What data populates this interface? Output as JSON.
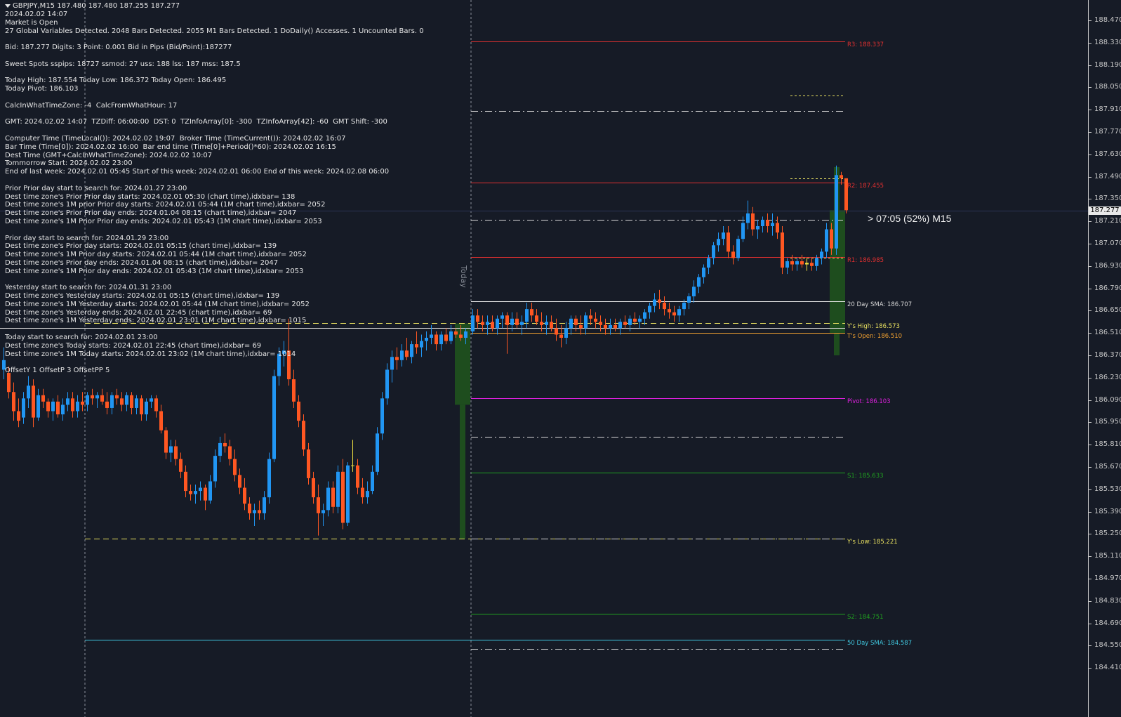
{
  "header": {
    "symbol_line": "GBPJPY,M15  187.480 187.480 187.255 187.277",
    "collapse_icon": "triangle-down-icon"
  },
  "info_lines": [
    "2024.02.02 14:07",
    "Market is Open",
    "27 Global Variables Detected. 2048 Bars Detected. 2055 M1 Bars Detected. 1 DoDaily() Accesses. 1 Uncounted Bars. 0",
    "",
    "Bid: 187.277 Digits: 3 Point: 0.001 Bid in Pips (Bid/Point):187277",
    "",
    "Sweet Spots sspips: 18727 ssmod: 27 uss: 188 lss: 187 mss: 187.5",
    "",
    "Today High: 187.554 Today Low: 186.372 Today Open: 186.495",
    "Today Pivot: 186.103",
    "",
    "CalcInWhatTimeZone: -4  CalcFromWhatHour: 17",
    "",
    "GMT: 2024.02.02 14:07  TZDiff: 06:00:00  DST: 0  TZInfoArray[0]: -300  TZInfoArray[42]: -60  GMT Shift: -300",
    "",
    "Computer Time (TimeLocal()): 2024.02.02 19:07  Broker Time (TimeCurrent()): 2024.02.02 16:07",
    "Bar Time (Time[0]): 2024.02.02 16:00  Bar end time (Time[0]+Period()*60): 2024.02.02 16:15",
    "Dest Time (GMT+CalcInWhatTimeZone): 2024.02.02 10:07",
    "Tommorrow Start: 2024.02.02 23:00",
    "End of last week: 2024.02.01 05:45 Start of this week: 2024.02.01 06:00 End of this week: 2024.02.08 06:00",
    "",
    "Prior Prior day start to search for: 2024.01.27 23:00",
    "Dest time zone's Prior Prior day starts: 2024.02.01 05:30 (chart time),idxbar= 138",
    "Dest time zone's 1M prior Prior day starts: 2024.02.01 05:44 (1M chart time),idxbar= 2052",
    "Dest time zone's Prior Prior day ends: 2024.01.04 08:15 (chart time),idxbar= 2047",
    "Dest time zone's 1M Prior Prior day ends: 2024.02.01 05:43 (1M chart time),idxbar= 2053",
    "",
    "Prior day start to search for: 2024.01.29 23:00",
    "Dest time zone's Prior day starts: 2024.02.01 05:15 (chart time),idxbar= 139",
    "Dest time zone's 1M Prior day starts: 2024.02.01 05:44 (1M chart time),idxbar= 2052",
    "Dest time zone's Prior day ends: 2024.01.04 08:15 (chart time),idxbar= 2047",
    "Dest time zone's 1M Prior day ends: 2024.02.01 05:43 (1M chart time),idxbar= 2053",
    "",
    "Yesterday start to search for: 2024.01.31 23:00",
    "Dest time zone's Yesterday starts: 2024.02.01 05:15 (chart time),idxbar= 139",
    "Dest time zone's 1M Yesterday starts: 2024.02.01 05:44 (1M chart time),idxbar= 2052",
    "Dest time zone's Yesterday ends: 2024.02.01 22:45 (chart time),idxbar= 69",
    "Dest time zone's 1M Yesterday ends: 2024.02.01 23:01 (1M chart time),idxbar= 1015",
    "",
    "Today start to search for: 2024.02.01 23:00",
    "Dest time zone's Today starts: 2024.02.01 22:45 (chart time),idxbar= 69",
    "Dest time zone's 1M Today starts: 2024.02.01 23:02 (1M chart time),idxbar= 1014",
    "",
    "OffsetY 1 OffsetP 3 OffsetPP 5"
  ],
  "price_axis": {
    "ticks": [
      "188.470",
      "188.330",
      "188.190",
      "188.050",
      "187.910",
      "187.770",
      "187.630",
      "187.490",
      "187.350",
      "187.210",
      "187.070",
      "186.930",
      "186.790",
      "186.650",
      "186.510",
      "186.370",
      "186.230",
      "186.090",
      "185.950",
      "185.810",
      "185.670",
      "185.530",
      "185.390",
      "185.250",
      "185.110",
      "184.970",
      "184.830",
      "184.690",
      "184.550",
      "184.410"
    ],
    "current_price": "187.277"
  },
  "levels": [
    {
      "name": "r3",
      "label": "R3: 188.337",
      "price": 188.337,
      "color": "#e03030",
      "style": "solid",
      "label_color": "#e03030"
    },
    {
      "name": "r2",
      "label": "R2: 187.455",
      "price": 187.455,
      "color": "#e03030",
      "style": "solid",
      "label_color": "#e03030"
    },
    {
      "name": "r1",
      "label": "R1: 186.985",
      "price": 186.985,
      "color": "#e03030",
      "style": "solid",
      "label_color": "#e03030"
    },
    {
      "name": "sma20",
      "label": "20 Day SMA: 186.707",
      "price": 186.707,
      "color": "#e8e8e8",
      "style": "solid",
      "label_color": "#d8d8d8"
    },
    {
      "name": "ys-high",
      "label": "Y's High: 186.573",
      "price": 186.573,
      "color": "#e8e060",
      "style": "dash",
      "label_color": "#e8e060"
    },
    {
      "name": "ts-open",
      "label": "T's Open: 186.510",
      "price": 186.51,
      "color": "#f0a030",
      "style": "solid",
      "label_color": "#f0a030"
    },
    {
      "name": "pivot",
      "label": "Pivot: 186.103",
      "price": 186.103,
      "color": "#e020e0",
      "style": "solid",
      "label_color": "#e020e0"
    },
    {
      "name": "s1",
      "label": "S1: 185.633",
      "price": 185.633,
      "color": "#20a020",
      "style": "solid",
      "label_color": "#20a020"
    },
    {
      "name": "ys-low",
      "label": "Y's Low: 185.221",
      "price": 185.221,
      "color": "#e8e060",
      "style": "dash",
      "label_color": "#e8e060"
    },
    {
      "name": "s2",
      "label": "S2: 184.751",
      "price": 184.751,
      "color": "#20a020",
      "style": "solid",
      "label_color": "#20a020"
    },
    {
      "name": "sma50",
      "label": "50 Day SMA: 184.587",
      "price": 184.587,
      "color": "#40c8e0",
      "style": "solid",
      "label_color": "#40c8e0"
    }
  ],
  "countdown": "> 07:05 (52%) M15",
  "today_label": "Today",
  "colors": {
    "background": "#161b26",
    "bull": "#2196f3",
    "bear": "#ff5722",
    "doji": "#f0e040",
    "day_range_box": "#1e4d1e",
    "grid_separator": "#8a8f99"
  }
}
